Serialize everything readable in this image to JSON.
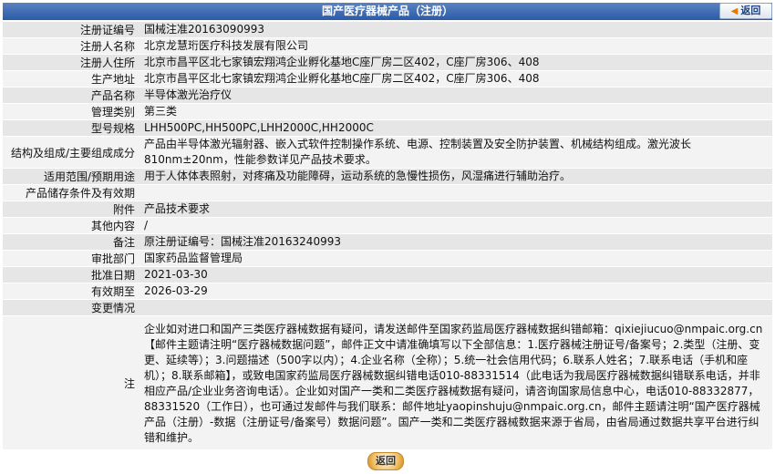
{
  "header": {
    "title": "国产医疗器械产品（注册）",
    "back_label": "返回"
  },
  "rows": [
    {
      "label": "注册证编号",
      "value": "国械注准20163090993"
    },
    {
      "label": "注册人名称",
      "value": "北京龙慧珩医疗科技发展有限公司"
    },
    {
      "label": "注册人住所",
      "value": "北京市昌平区北七家镇宏翔鸿企业孵化基地C座厂房二区402，C座厂房306、408"
    },
    {
      "label": "生产地址",
      "value": "北京市昌平区北七家镇宏翔鸿企业孵化基地C座厂房二区402，C座厂房306、408"
    },
    {
      "label": "产品名称",
      "value": "半导体激光治疗仪"
    },
    {
      "label": "管理类别",
      "value": "第三类"
    },
    {
      "label": "型号规格",
      "value": "LHH500PC,HH500PC,LHH2000C,HH2000C"
    },
    {
      "label": "结构及组成/主要组成成分",
      "value": "产品由半导体激光辐射器、嵌入式软件控制操作系统、电源、控制装置及安全防护装置、机械结构组成。激光波长810nm±20nm，性能参数详见产品技术要求。"
    },
    {
      "label": "适用范围/预期用途",
      "value": "用于人体体表照射，对疼痛及功能障碍，运动系统的急慢性损伤，风湿痛进行辅助治疗。"
    },
    {
      "label": "产品储存条件及有效期",
      "value": ""
    },
    {
      "label": "附件",
      "value": "产品技术要求"
    },
    {
      "label": "其他内容",
      "value": "/"
    },
    {
      "label": "备注",
      "value": "原注册证编号：国械注准20163240993"
    },
    {
      "label": "审批部门",
      "value": "国家药品监督管理局"
    },
    {
      "label": "批准日期",
      "value": "2021-03-30"
    },
    {
      "label": "有效期至",
      "value": "2026-03-29"
    },
    {
      "label": "变更情况",
      "value": ""
    },
    {
      "label": "注",
      "value": "企业如对进口和国产三类医疗器械数据有疑问，请发送邮件至国家药监局医疗器械数据纠错邮箱：qixiejiucuo@nmpaic.org.cn【邮件主题请注明“医疗器械数据问题”，邮件正文中请准确填写以下全部信息：1.医疗器械注册证号/备案号；2.类型（注册、变更、延续等）；3.问题描述（500字以内）；4.企业名称（全称）；5.统一社会信用代码；6.联系人姓名；7.联系电话（手机和座机）；8.联系邮箱】，或致电国家药监局医疗器械数据纠错电话010-88331514（此电话为我局医疗器械数据纠错联系电话，并非相应产品/企业业务咨询电话）。企业如对国产一类和二类医疗器械数据有疑问，请咨询国家局信息中心，电话010-88332877，88331520（工作日），也可通过发邮件与我们联系：邮件地址yaopinshuju@nmpaic.org.cn，邮件主题请注明“国产医疗器械产品（注册）-数据（注册证号/备案号）数据问题”。国产一类和二类医疗器械数据来源于省局，由省局通过数据共享平台进行纠错和维护。"
    }
  ],
  "footer": {
    "back_label": "返回"
  }
}
